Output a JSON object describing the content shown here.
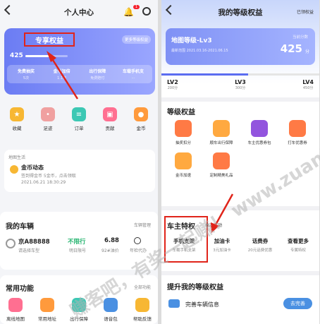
{
  "left": {
    "title": "个人中心",
    "badge_count": "1",
    "exclusive_label": "专享权益",
    "more_label": "更多等级权益",
    "points_value": "425",
    "stats": [
      {
        "t": "免费抽奖",
        "s": "5次"
      },
      {
        "t": "金币加倍",
        "s": "1.1倍"
      },
      {
        "t": "出行保障",
        "s": "免费赔付"
      },
      {
        "t": "车载手机支",
        "s": "..."
      }
    ],
    "quick": [
      {
        "l": "收藏",
        "c": "#f7b733",
        "i": "★"
      },
      {
        "l": "足迹",
        "c": "#f0a0a0",
        "i": "•"
      },
      {
        "l": "订单",
        "c": "#3cc8b4",
        "i": "≡"
      },
      {
        "l": "贡献",
        "c": "#ff6f91",
        "i": "▣"
      },
      {
        "l": "金币",
        "c": "#ff9a3c",
        "i": "●"
      }
    ],
    "feed_header": "地图生活",
    "feed_title": "金币动态",
    "feed_sub": "签到得金币 5金币，点击领取",
    "feed_date": "2021.06.21 18:30:29",
    "vehicle_title": "我的车辆",
    "vehicle_manage": "车辆管理",
    "plate": "京A88888",
    "plate_sub": "请选择车型",
    "limit_value": "不限行",
    "limit_label": "明日限号",
    "fuel_value": "6.88",
    "fuel_label": "92#油价",
    "extra_label": "年检代办",
    "common_title": "常用功能",
    "common_all": "全部功能",
    "functions": [
      {
        "l": "离线地图",
        "c": "#ff6f91"
      },
      {
        "l": "常用地址",
        "c": "#ff9a3c"
      },
      {
        "l": "出行保障",
        "c": "#3cc8b4"
      },
      {
        "l": "语音包",
        "c": "#4a90e2"
      },
      {
        "l": "帮助反馈",
        "c": "#f7b733"
      }
    ]
  },
  "right": {
    "title": "我的等级权益",
    "top_right": "已领权益",
    "level_title": "地图等级-Lv3",
    "level_date": "最新范围 2021.03.16-2021.06.15",
    "score_label": "当前分数",
    "score": "425",
    "score_unit": "分",
    "levels": [
      {
        "n": "LV2",
        "p": "200分"
      },
      {
        "n": "LV3",
        "p": "300分"
      },
      {
        "n": "LV4",
        "p": "450分"
      }
    ],
    "level_section": "等级权益",
    "perks": [
      {
        "l": "抽奖扣分",
        "c": "#ff7a45"
      },
      {
        "l": "顺车出行保障",
        "c": "#ffa940"
      },
      {
        "l": "车主优惠券包",
        "c": "#9254de"
      },
      {
        "l": "打车优惠券",
        "c": "#ff7a45"
      },
      {
        "l": "金币加速",
        "c": "#ffa940"
      },
      {
        "l": "定制精美礼品",
        "c": "#ff7a45"
      }
    ],
    "owner_title": "车主特权",
    "owner_sub": "认证车主特权",
    "owner_tag": "本次活动",
    "owner_items": [
      {
        "t": "手机支架",
        "s": "车载手机支架"
      },
      {
        "t": "加油卡",
        "s": "3元加油卡"
      },
      {
        "t": "话费券",
        "s": "20元话费优惠"
      },
      {
        "t": "查看更多",
        "s": "专属特权"
      }
    ],
    "upgrade_title": "提升我的等级权益",
    "task_label": "完善车辆信息",
    "task_button": "去完善"
  },
  "watermark": "赚客吧，有奖一起赚！ www.zuanke8.com",
  "colors": {
    "accent": "#5b6cf0",
    "highlight": "#e0241a",
    "lightblue": "#7fa4f7"
  }
}
